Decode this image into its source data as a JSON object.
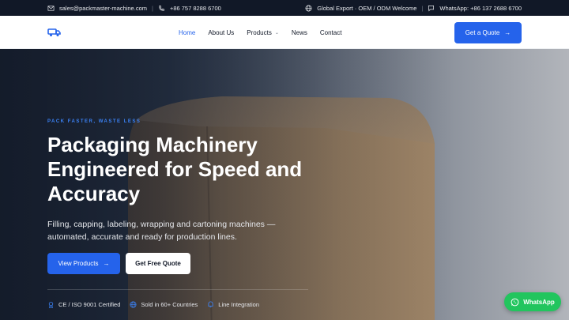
{
  "topbar": {
    "email": "sales@packmaster-machine.com",
    "phone": "+86 757 8288 6700",
    "tagline": "Global Export · OEM / ODM Welcome",
    "whatsapp": "WhatsApp: +86 137 2688 6700"
  },
  "nav": {
    "items": [
      {
        "label": "Home",
        "active": true
      },
      {
        "label": "About Us"
      },
      {
        "label": "Products"
      },
      {
        "label": "News"
      },
      {
        "label": "Contact"
      }
    ],
    "cta_label": "Get a Quote"
  },
  "hero": {
    "eyebrow": "PACK FASTER, WASTE LESS",
    "title_lines": [
      "Packaging Machinery",
      "Engineered for Speed and",
      "Accuracy"
    ],
    "subtitle": "Filling, capping, labeling, wrapping and cartoning machines — automated, accurate and ready for production lines.",
    "primary_button": "View Products",
    "secondary_button": "Get Free Quote",
    "features": [
      {
        "icon": "certificate-icon",
        "label": "CE / ISO 9001 Certified"
      },
      {
        "icon": "globe-icon",
        "label": "Sold in 60+ Countries"
      },
      {
        "icon": "line-icon",
        "label": "Line Integration"
      }
    ]
  },
  "whatsapp_button": "WhatsApp",
  "colors": {
    "accent": "#2563eb",
    "topbar_bg": "#111827",
    "whatsapp": "#22c55e"
  }
}
